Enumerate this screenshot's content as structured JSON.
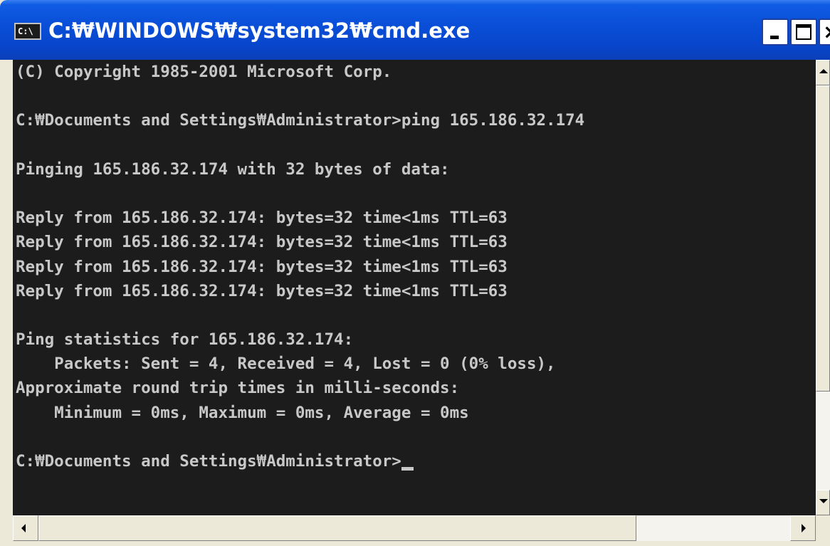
{
  "window": {
    "title": "C:₩WINDOWS₩system32₩cmd.exe",
    "icon_label": "C:\\",
    "icon": "cmd-icon",
    "controls": {
      "minimize_icon": "minimize-icon",
      "maximize_icon": "maximize-icon",
      "close_icon": "close-icon",
      "close_glyph": "×"
    }
  },
  "console": {
    "colors": {
      "background": "#1c1c1c",
      "text": "#c8c8c8"
    },
    "lines": [
      "(C) Copyright 1985-2001 Microsoft Corp.",
      "",
      "C:₩Documents and Settings₩Administrator>ping 165.186.32.174",
      "",
      "Pinging 165.186.32.174 with 32 bytes of data:",
      "",
      "Reply from 165.186.32.174: bytes=32 time<1ms TTL=63",
      "Reply from 165.186.32.174: bytes=32 time<1ms TTL=63",
      "Reply from 165.186.32.174: bytes=32 time<1ms TTL=63",
      "Reply from 165.186.32.174: bytes=32 time<1ms TTL=63",
      "",
      "Ping statistics for 165.186.32.174:",
      "    Packets: Sent = 4, Received = 4, Lost = 0 (0% loss),",
      "Approximate round trip times in milli-seconds:",
      "    Minimum = 0ms, Maximum = 0ms, Average = 0ms",
      "",
      "C:₩Documents and Settings₩Administrator>"
    ]
  },
  "scrollbars": {
    "vertical": {
      "up_icon": "scroll-up-arrow-icon",
      "down_icon": "scroll-down-arrow-icon"
    },
    "horizontal": {
      "left_icon": "scroll-left-arrow-icon",
      "right_icon": "scroll-right-arrow-icon"
    }
  }
}
